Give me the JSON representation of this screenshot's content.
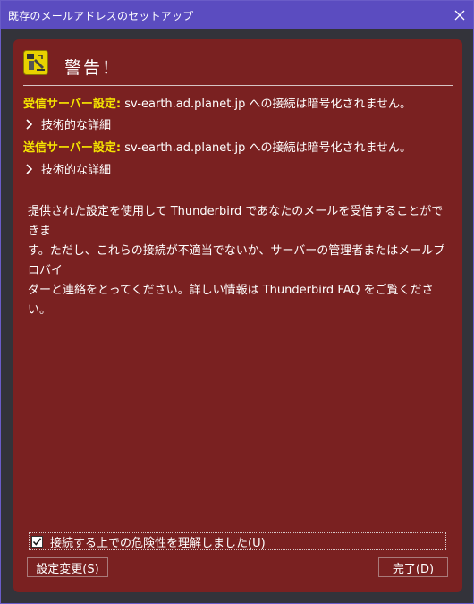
{
  "window": {
    "title": "既存のメールアドレスのセットアップ"
  },
  "header": {
    "title": "警告！"
  },
  "incoming": {
    "label": "受信サーバー設定:",
    "text": "sv-earth.ad.planet.jp への接続は暗号化されません。",
    "details": "技術的な詳細"
  },
  "outgoing": {
    "label": "送信サーバー設定:",
    "text": "sv-earth.ad.planet.jp への接続は暗号化されません。",
    "details": "技術的な詳細"
  },
  "message": {
    "line1": "提供された設定を使用して Thunderbird であなたのメールを受信することができま",
    "line2": "す。ただし、これらの接続が不適当でないか、サーバーの管理者またはメールプロバイ",
    "line3": "ダーと連絡をとってください。詳しい情報は Thunderbird FAQ をご覧ください。"
  },
  "acknowledge": {
    "label": "接続する上での危険性を理解しました(U)",
    "checked": true
  },
  "buttons": {
    "settings": "設定変更(S)",
    "done": "完了(D)"
  },
  "colors": {
    "titlebar": "#5b4cc0",
    "panel": "#7a2121",
    "label": "#f5e400"
  }
}
